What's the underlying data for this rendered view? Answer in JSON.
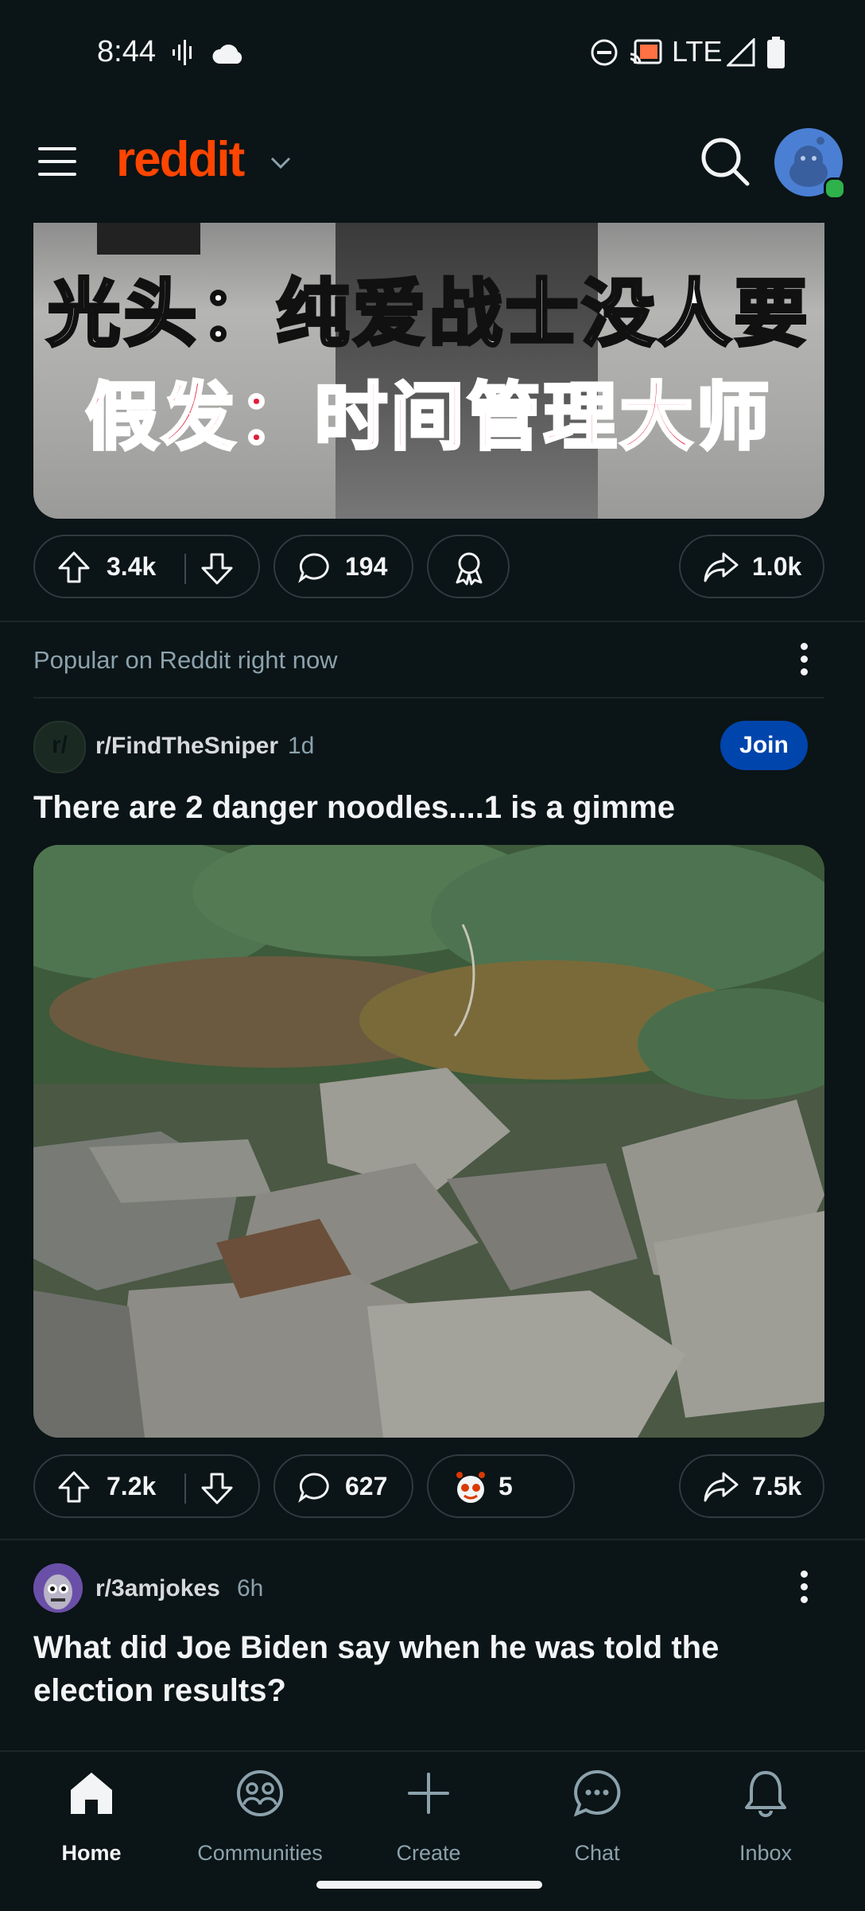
{
  "status_bar": {
    "time": "8:44",
    "network": "LTE"
  },
  "header": {
    "logo": "reddit"
  },
  "post1": {
    "meme_line1": "光头：纯爱战士没人要",
    "meme_line2": "假发：时间管理大师",
    "upvotes": "3.4k",
    "comments": "194",
    "shares": "1.0k"
  },
  "popular_label": "Popular on Reddit right now",
  "post2": {
    "subreddit": "r/FindTheSniper",
    "avatar_text": "r/",
    "age": "1d",
    "join_label": "Join",
    "title": "There are 2 danger noodles....1 is a gimme",
    "upvotes": "7.2k",
    "comments": "627",
    "awards": "5",
    "shares": "7.5k"
  },
  "post3": {
    "subreddit": "r/3amjokes",
    "age": "6h",
    "title": "What did Joe Biden say when he was told the election results?"
  },
  "nav": {
    "home": "Home",
    "communities": "Communities",
    "create": "Create",
    "chat": "Chat",
    "inbox": "Inbox"
  },
  "colors": {
    "brand": "#ff4500",
    "join": "#0045ac",
    "background": "#0b1416"
  }
}
